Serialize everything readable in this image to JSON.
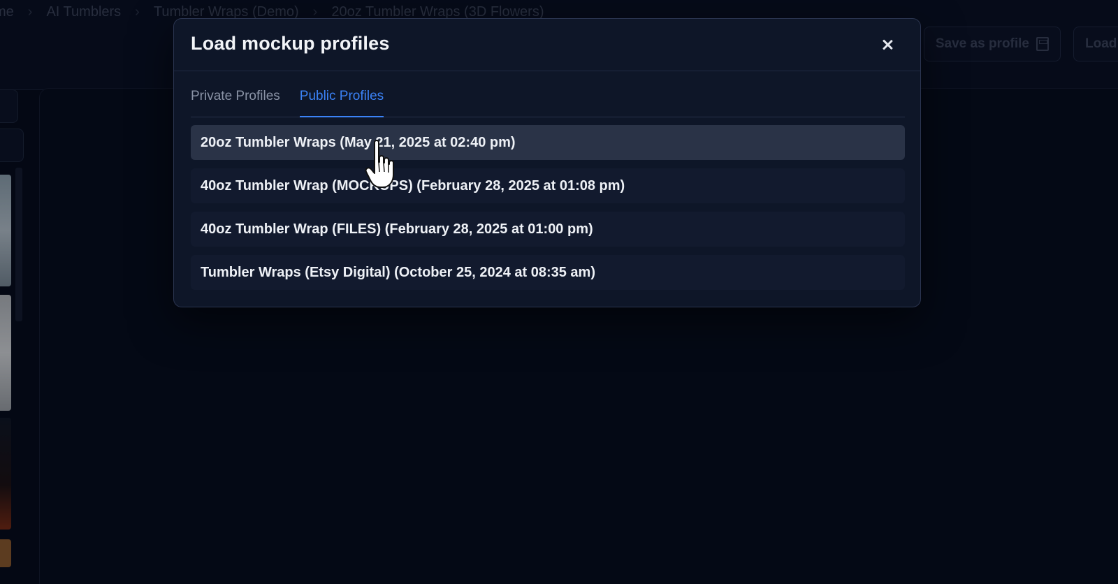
{
  "breadcrumb": [
    "me",
    "AI Tumblers",
    "Tumbler Wraps (Demo)",
    "20oz Tumbler Wraps (3D Flowers)"
  ],
  "toolbar": {
    "save_profile_label": "Save as profile",
    "load_label": "Load"
  },
  "modal": {
    "title": "Load mockup profiles",
    "tabs": [
      {
        "label": "Private Profiles",
        "active": false
      },
      {
        "label": "Public Profiles",
        "active": true
      }
    ],
    "profiles": [
      {
        "label": "20oz Tumbler Wraps (May 21, 2025 at 02:40 pm)",
        "hovered": true
      },
      {
        "label": "40oz Tumbler Wrap (MOCKUPS) (February 28, 2025 at 01:08 pm)",
        "hovered": false
      },
      {
        "label": "40oz Tumbler Wrap (FILES) (February 28, 2025 at 01:00 pm)",
        "hovered": false
      },
      {
        "label": "Tumbler Wraps (Etsy Digital) (October 25, 2024 at 08:35 am)",
        "hovered": false
      }
    ]
  },
  "colors": {
    "accent": "#3b82f6",
    "modal_bg": "#0e1628",
    "page_bg": "#050a18"
  },
  "icons": {
    "close": "close-icon",
    "save": "save-icon",
    "cursor": "hand-pointer-cursor-icon"
  }
}
